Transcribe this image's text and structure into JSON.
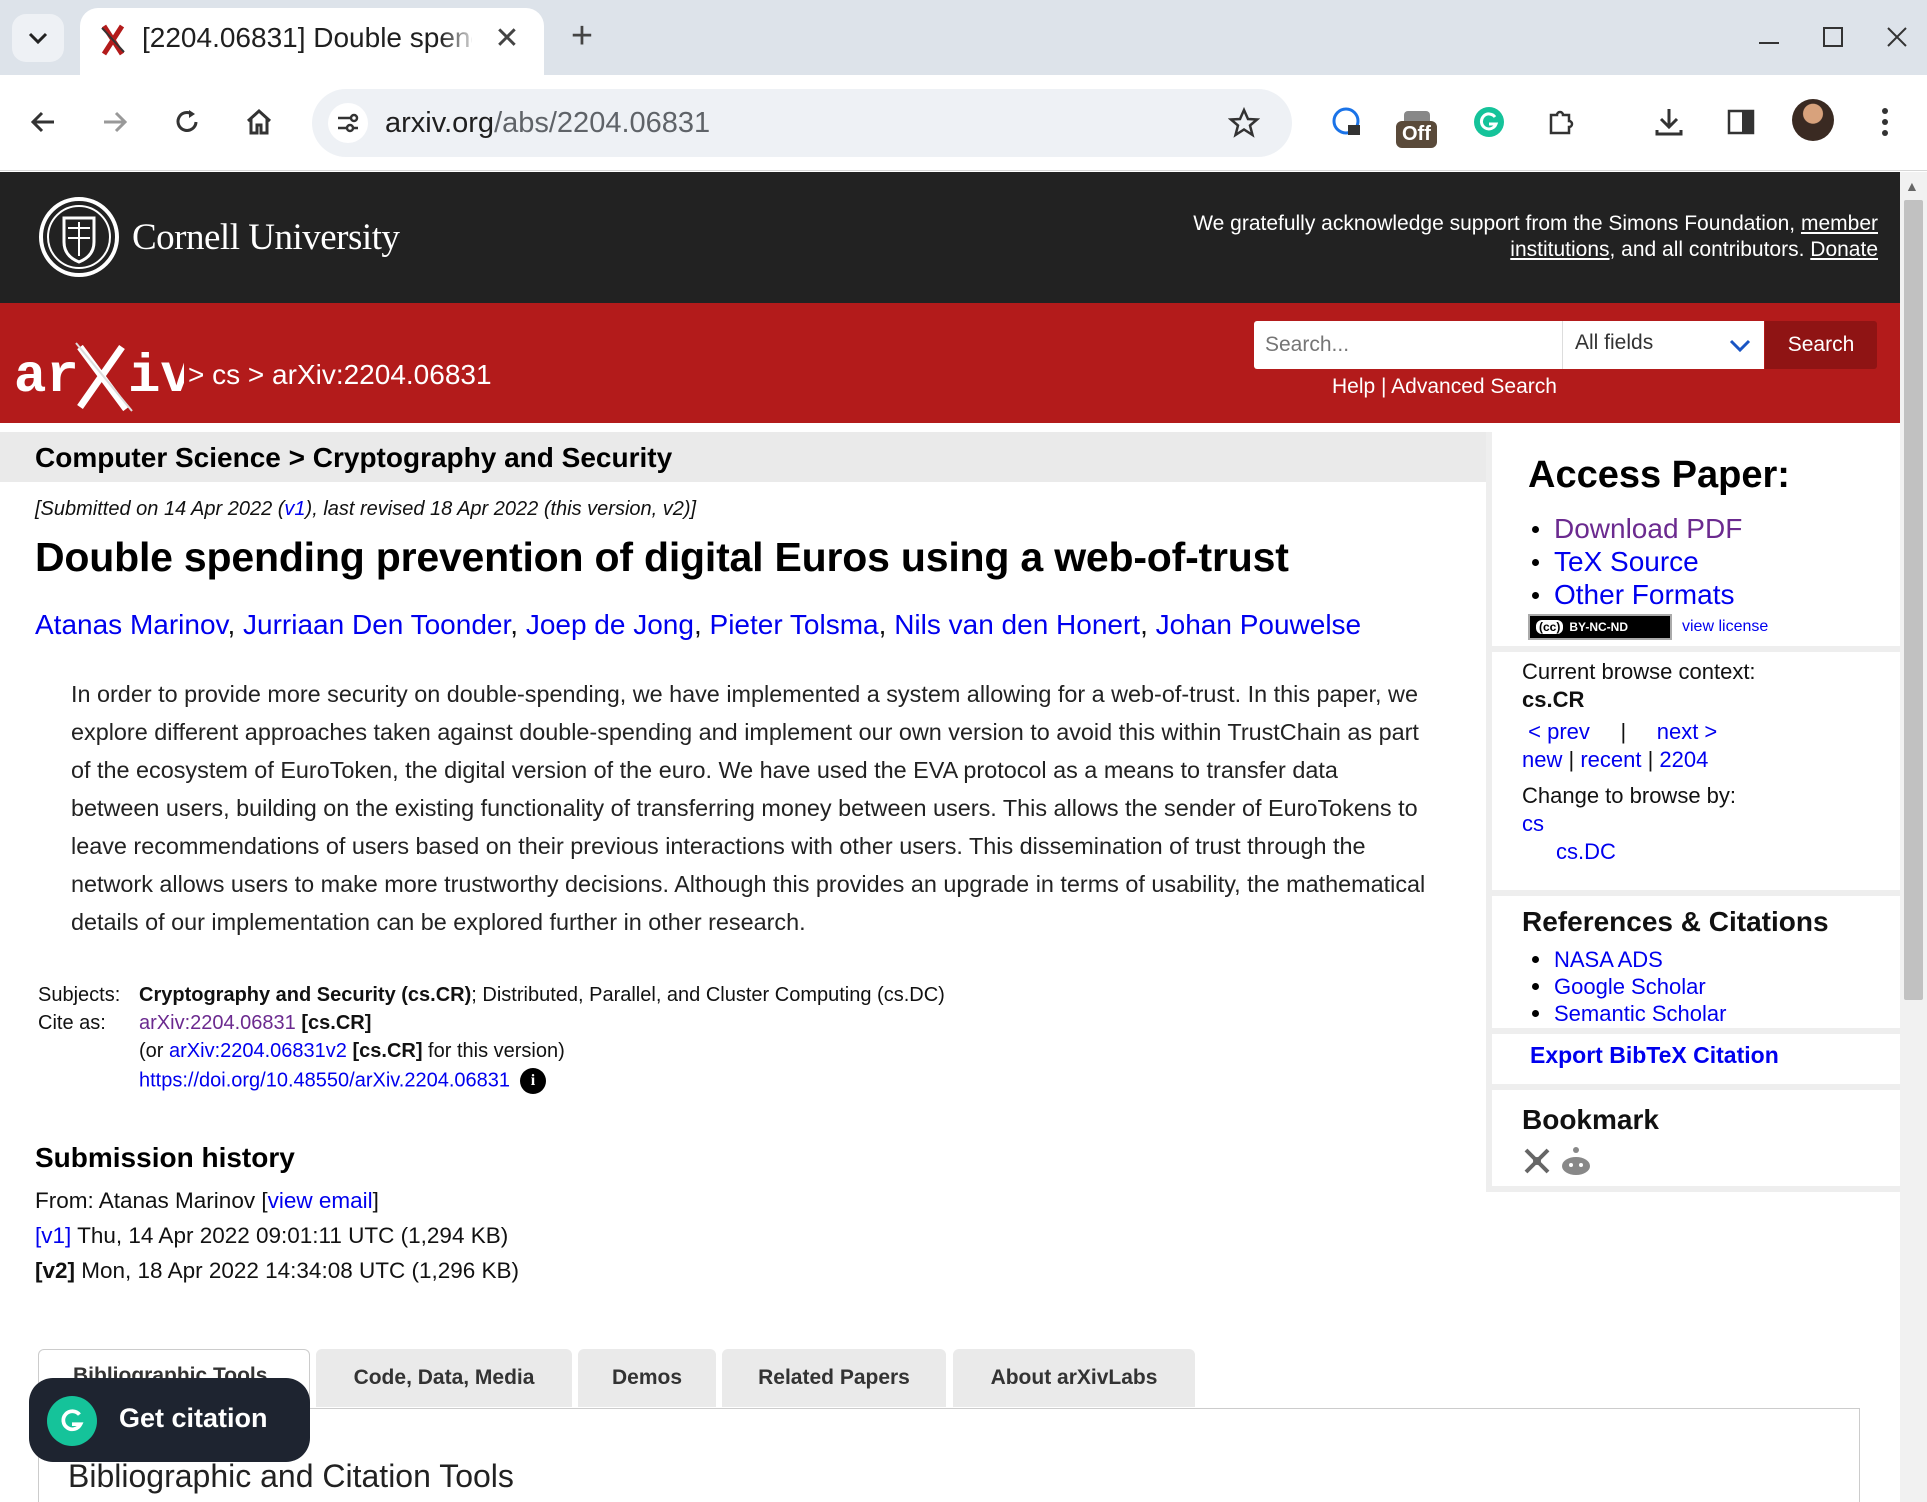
{
  "browser": {
    "tab_title": "[2204.06831] Double spending prevention of digital Euros using a web-of-trust",
    "url_host": "arxiv.org",
    "url_path": "/abs/2204.06831",
    "extension_badge": "Off"
  },
  "cornell": {
    "name": "Cornell University",
    "ack_prefix": "We gratefully acknowledge support from the Simons Foundation, ",
    "ack_link_member": "member institutions",
    "ack_middle": ", and all contributors. ",
    "ack_link_donate": "Donate"
  },
  "header": {
    "breadcrumb": "> cs > arXiv:2204.06831",
    "search_placeholder": "Search...",
    "field_select": "All fields",
    "search_button": "Search",
    "help": "Help",
    "separator": " | ",
    "advanced_search": "Advanced Search"
  },
  "subheader": "Computer Science > Cryptography and Security",
  "dateline": {
    "prefix": "[Submitted on 14 Apr 2022 (",
    "v1": "v1",
    "suffix": "), last revised 18 Apr 2022 (this version, v2)]"
  },
  "title": "Double spending prevention of digital Euros using a web-of-trust",
  "authors": [
    "Atanas Marinov",
    "Jurriaan Den Toonder",
    "Joep de Jong",
    "Pieter Tolsma",
    "Nils van den Honert",
    "Johan Pouwelse"
  ],
  "abstract": "In order to provide more security on double-spending, we have implemented a system allowing for a web-of-trust. In this paper, we explore different approaches taken against double-spending and implement our own version to avoid this within TrustChain as part of the ecosystem of EuroToken, the digital version of the euro. We have used the EVA protocol as a means to transfer data between users, building on the existing functionality of transferring money between users. This allows the sender of EuroTokens to leave recommendations of users based on their previous interactions with other users. This dissemination of trust through the network allows users to make more trustworthy decisions. Although this provides an upgrade in terms of usability, the mathematical details of our implementation can be explored further in other research.",
  "meta": {
    "subjects_label": "Subjects:",
    "subjects_primary": "Cryptography and Security (cs.CR)",
    "subjects_rest": "; Distributed, Parallel, and Cluster Computing (cs.DC)",
    "cite_label": "Cite as:",
    "cite_id": "arXiv:2204.06831",
    "cite_cat": " [cs.CR]",
    "or_prefix": "(or ",
    "cite_v2": "arXiv:2204.06831v2",
    "or_cat": " [cs.CR]",
    "or_suffix": " for this version)",
    "doi": "https://doi.org/10.48550/arXiv.2204.06831"
  },
  "history": {
    "title": "Submission history",
    "from_prefix": "From: Atanas Marinov [",
    "view_email": "view email",
    "from_suffix": "]",
    "v1_label": "[v1]",
    "v1_text": " Thu, 14 Apr 2022 09:01:11 UTC (1,294 KB)",
    "v2_label": "[v2]",
    "v2_text": " Mon, 18 Apr 2022 14:34:08 UTC (1,296 KB)"
  },
  "labs": {
    "tabs": [
      "Bibliographic Tools",
      "Code, Data, Media",
      "Demos",
      "Related Papers",
      "About arXivLabs"
    ],
    "panel_title": "Bibliographic and Citation Tools"
  },
  "grammarly": {
    "label": "Get citation"
  },
  "sidebar": {
    "access_title": "Access Paper:",
    "access_links": [
      "Download PDF",
      "TeX Source",
      "Other Formats"
    ],
    "license_badge": "BY-NC-ND",
    "license_cc": "(cc)",
    "view_license": "view license",
    "browse_context_label": "Current browse context:",
    "browse_context_value": "cs.CR",
    "prev": "< prev",
    "pipe": "|",
    "next": "next >",
    "new": "new",
    "recent": "recent",
    "year": "2204",
    "change_browse": "Change to browse by:",
    "browse_cs": "cs",
    "browse_csdc": "cs.DC",
    "refs_title": "References & Citations",
    "refs_links": [
      "NASA ADS",
      "Google Scholar",
      "Semantic Scholar"
    ],
    "export_bibtex": "Export BibTeX Citation",
    "bookmark_title": "Bookmark"
  }
}
